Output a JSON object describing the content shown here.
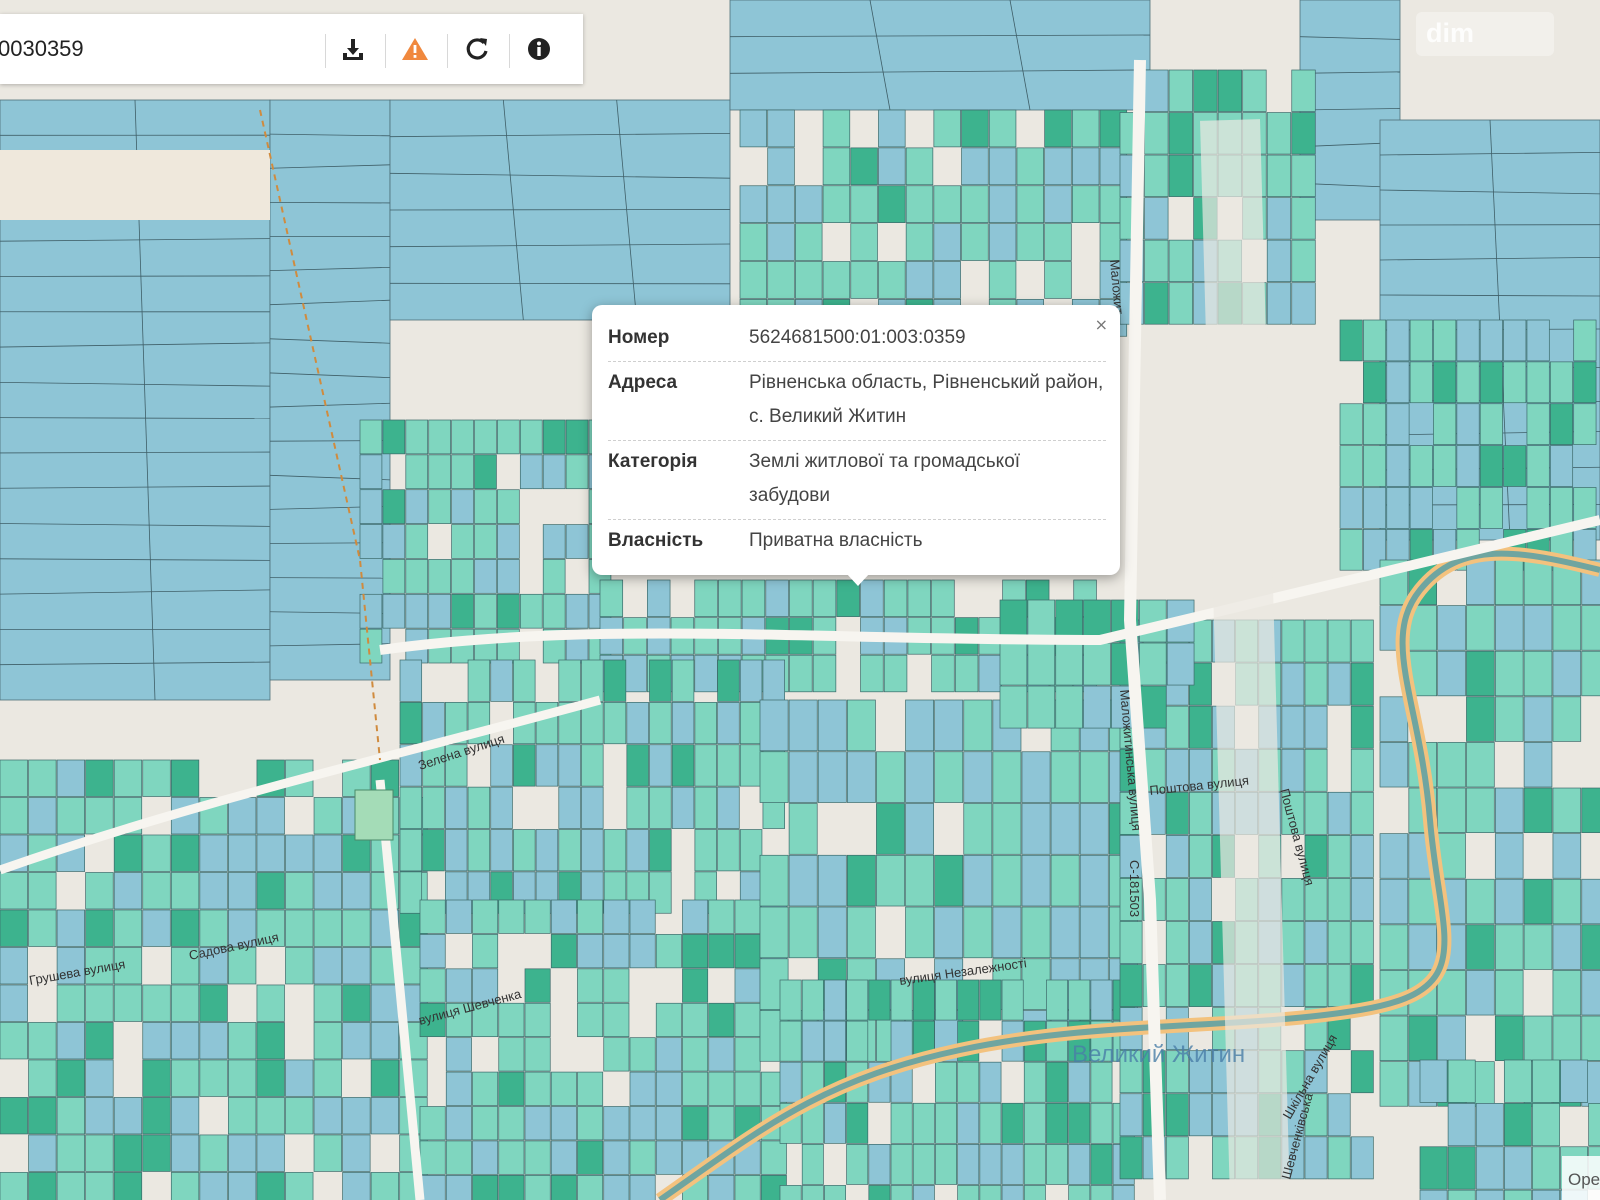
{
  "toolbar": {
    "search_value": "0030359",
    "buttons": [
      {
        "icon": "download-icon"
      },
      {
        "icon": "warning-icon",
        "color": "#f0883e"
      },
      {
        "icon": "refresh-icon"
      },
      {
        "icon": "info-icon"
      }
    ]
  },
  "popup": {
    "close_label": "×",
    "rows": [
      {
        "label": "Номер",
        "value": "5624681500:01:003:0359"
      },
      {
        "label": "Адреса",
        "value": "Рівненська область, Рівненський район, с. Великий Житин"
      },
      {
        "label": "Категорія",
        "value": "Землі житлової та громадської забудови"
      },
      {
        "label": "Власність",
        "value": "Приватна власність"
      }
    ]
  },
  "map_labels": {
    "village": "Великий Житин",
    "streets": [
      "Зелена вулиця",
      "Садова вулиця",
      "Грушева вулиця",
      "вулиця Шевченка",
      "вулиця Незалежності",
      "Поштова вулиця",
      "Поштова вулиця",
      "Маложитинська вулиця",
      "Маложит",
      "С-181503",
      "Шкільна вулиця",
      "Шевченківська"
    ]
  },
  "attribution": "Ope",
  "watermark": "dim",
  "colors": {
    "parcel_blue": "#8ec5d6",
    "parcel_green": "#7fd6bf",
    "parcel_dark_green": "#3db38e",
    "road_orange": "#f3c27e",
    "river": "#6fa5a0",
    "background": "#ebe8e1"
  }
}
